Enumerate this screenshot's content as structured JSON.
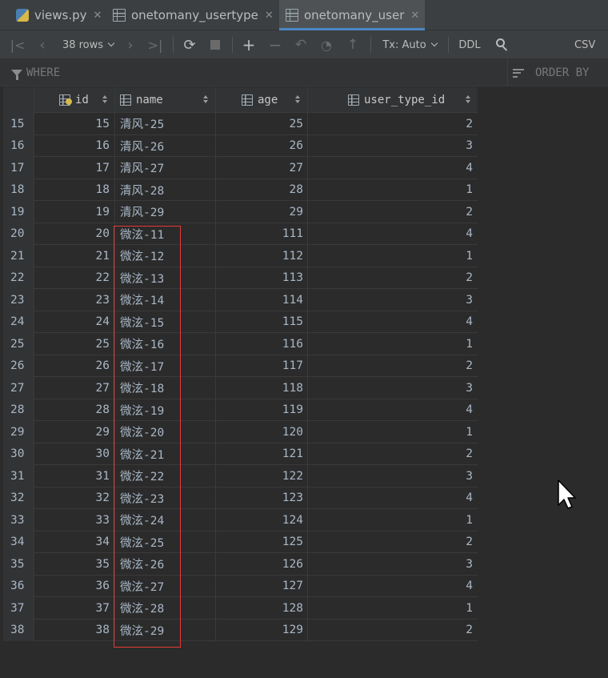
{
  "tabs": [
    {
      "label": "views.py",
      "icon": "python-file-icon",
      "closable": true,
      "active": false
    },
    {
      "label": "onetomany_usertype",
      "icon": "table-icon",
      "closable": true,
      "active": false
    },
    {
      "label": "onetomany_user",
      "icon": "table-icon",
      "closable": true,
      "active": true
    }
  ],
  "toolbar": {
    "rows_label": "38 rows",
    "tx_label": "Tx: Auto",
    "ddl_label": "DDL",
    "csv_label": "CSV"
  },
  "filter": {
    "where_label": "WHERE",
    "orderby_label": "ORDER BY"
  },
  "columns": [
    {
      "label": "id",
      "key": true
    },
    {
      "label": "name",
      "key": false
    },
    {
      "label": "age",
      "key": false
    },
    {
      "label": "user_type_id",
      "key": false
    }
  ],
  "rows": [
    {
      "rn": "15",
      "id": "15",
      "name": "清风-25",
      "age": "25",
      "user_type_id": "2"
    },
    {
      "rn": "16",
      "id": "16",
      "name": "清风-26",
      "age": "26",
      "user_type_id": "3"
    },
    {
      "rn": "17",
      "id": "17",
      "name": "清风-27",
      "age": "27",
      "user_type_id": "4"
    },
    {
      "rn": "18",
      "id": "18",
      "name": "清风-28",
      "age": "28",
      "user_type_id": "1"
    },
    {
      "rn": "19",
      "id": "19",
      "name": "清风-29",
      "age": "29",
      "user_type_id": "2"
    },
    {
      "rn": "20",
      "id": "20",
      "name": "微泫-11",
      "age": "111",
      "user_type_id": "4"
    },
    {
      "rn": "21",
      "id": "21",
      "name": "微泫-12",
      "age": "112",
      "user_type_id": "1"
    },
    {
      "rn": "22",
      "id": "22",
      "name": "微泫-13",
      "age": "113",
      "user_type_id": "2"
    },
    {
      "rn": "23",
      "id": "23",
      "name": "微泫-14",
      "age": "114",
      "user_type_id": "3"
    },
    {
      "rn": "24",
      "id": "24",
      "name": "微泫-15",
      "age": "115",
      "user_type_id": "4"
    },
    {
      "rn": "25",
      "id": "25",
      "name": "微泫-16",
      "age": "116",
      "user_type_id": "1"
    },
    {
      "rn": "26",
      "id": "26",
      "name": "微泫-17",
      "age": "117",
      "user_type_id": "2"
    },
    {
      "rn": "27",
      "id": "27",
      "name": "微泫-18",
      "age": "118",
      "user_type_id": "3"
    },
    {
      "rn": "28",
      "id": "28",
      "name": "微泫-19",
      "age": "119",
      "user_type_id": "4"
    },
    {
      "rn": "29",
      "id": "29",
      "name": "微泫-20",
      "age": "120",
      "user_type_id": "1"
    },
    {
      "rn": "30",
      "id": "30",
      "name": "微泫-21",
      "age": "121",
      "user_type_id": "2"
    },
    {
      "rn": "31",
      "id": "31",
      "name": "微泫-22",
      "age": "122",
      "user_type_id": "3"
    },
    {
      "rn": "32",
      "id": "32",
      "name": "微泫-23",
      "age": "123",
      "user_type_id": "4"
    },
    {
      "rn": "33",
      "id": "33",
      "name": "微泫-24",
      "age": "124",
      "user_type_id": "1"
    },
    {
      "rn": "34",
      "id": "34",
      "name": "微泫-25",
      "age": "125",
      "user_type_id": "2"
    },
    {
      "rn": "35",
      "id": "35",
      "name": "微泫-26",
      "age": "126",
      "user_type_id": "3"
    },
    {
      "rn": "36",
      "id": "36",
      "name": "微泫-27",
      "age": "127",
      "user_type_id": "4"
    },
    {
      "rn": "37",
      "id": "37",
      "name": "微泫-28",
      "age": "128",
      "user_type_id": "1"
    },
    {
      "rn": "38",
      "id": "38",
      "name": "微泫-29",
      "age": "129",
      "user_type_id": "2"
    }
  ],
  "colors": {
    "background": "#2b2b2b",
    "active_tab_accent": "#4a88c7",
    "highlight_box": "#e53935",
    "key_icon": "#d6b84e"
  }
}
